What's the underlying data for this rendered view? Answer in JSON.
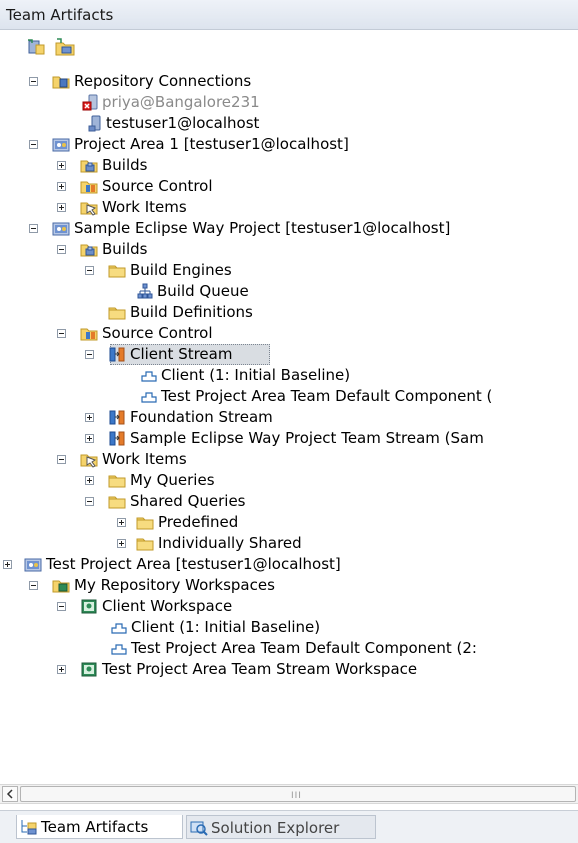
{
  "window": {
    "title": "Team Artifacts"
  },
  "toolbar": {
    "icons": [
      "repository-connect-icon",
      "project-area-connect-icon"
    ]
  },
  "tree": {
    "repository_connections": {
      "label": "Repository Connections",
      "conn_priya": "priya@Bangalore231",
      "conn_testuser": "testuser1@localhost"
    },
    "project_area_1": {
      "label": "Project Area 1 [testuser1@localhost]",
      "builds": "Builds",
      "source_control": "Source Control",
      "work_items": "Work Items"
    },
    "sample_project": {
      "label": "Sample Eclipse Way Project [testuser1@localhost]",
      "builds": "Builds",
      "build_engines": "Build Engines",
      "build_queue": "Build Queue",
      "build_definitions": "Build Definitions",
      "source_control": "Source Control",
      "client_stream": "Client Stream",
      "client_component": "Client (1: Initial Baseline)",
      "test_component": "Test Project Area Team Default Component (",
      "foundation_stream": "Foundation Stream",
      "team_stream": "Sample Eclipse Way Project Team Stream (Sam",
      "work_items": "Work Items",
      "my_queries": "My Queries",
      "shared_queries": "Shared Queries",
      "predefined": "Predefined",
      "individually_shared": "Individually Shared"
    },
    "test_project_area": {
      "label": "Test Project Area [testuser1@localhost]"
    },
    "my_workspaces": {
      "label": "My Repository Workspaces",
      "client_workspace": "Client Workspace",
      "client_component": "Client (1: Initial Baseline)",
      "test_component": "Test Project Area Team Default Component (2:",
      "team_stream_workspace": "Test Project Area Team Stream Workspace"
    }
  },
  "tabs": {
    "team_artifacts": "Team Artifacts",
    "solution_explorer": "Solution Explorer"
  },
  "scrollbar": {
    "grip": "III"
  },
  "colors": {
    "selection": "#d9dde2",
    "folder": "#f2cc5c",
    "stream": "#3c78c8",
    "grey_text": "#8a8a8a"
  }
}
